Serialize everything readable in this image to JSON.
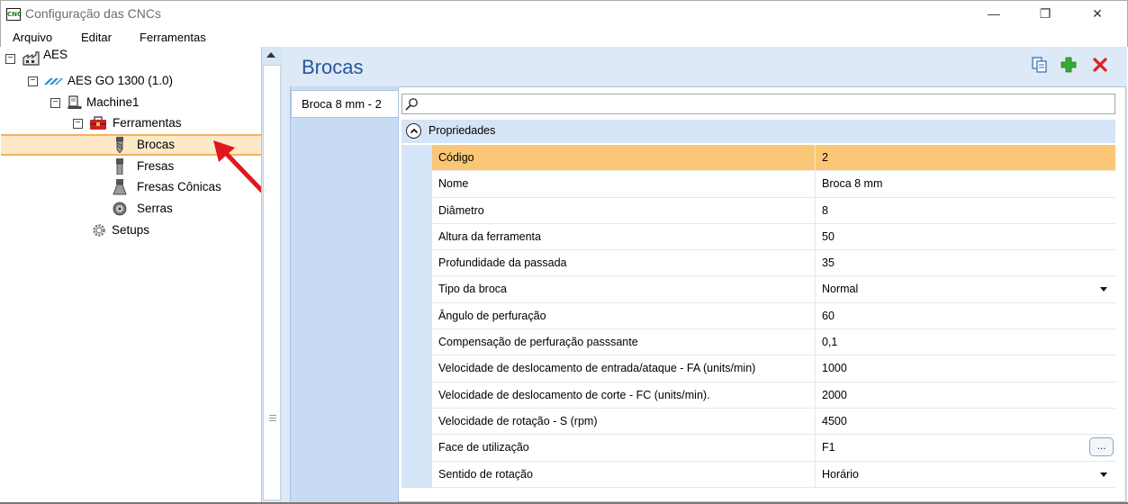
{
  "window": {
    "icon_text": "CNC",
    "title": "Configuração das CNCs",
    "minimize_glyph": "—",
    "maximize_glyph": "❐",
    "close_glyph": "✕"
  },
  "menu": [
    "Arquivo",
    "Editar",
    "Ferramentas"
  ],
  "tree": {
    "items": [
      {
        "label": "AES",
        "icon": "factory-icon",
        "expanded": true
      },
      {
        "label": "AES GO 1300 (1.0)",
        "icon": "machine-brand-icon",
        "expanded": true
      },
      {
        "label": "Machine1",
        "icon": "machine-icon",
        "expanded": true
      },
      {
        "label": "Ferramentas",
        "icon": "toolbox-icon",
        "expanded": true
      },
      {
        "label": "Brocas",
        "icon": "drill-bit-icon",
        "selected": true
      },
      {
        "label": "Fresas",
        "icon": "mill-icon"
      },
      {
        "label": "Fresas Cônicas",
        "icon": "conical-mill-icon"
      },
      {
        "label": "Serras",
        "icon": "saw-icon"
      },
      {
        "label": "Setups",
        "icon": "gear-icon"
      }
    ],
    "toggle_glyph": "−"
  },
  "panel": {
    "title": "Brocas",
    "actions": [
      {
        "name": "copy-icon"
      },
      {
        "name": "add-icon",
        "color": "#3aa838"
      },
      {
        "name": "delete-icon",
        "color": "#e02020"
      }
    ],
    "tabs": [
      {
        "label": "Broca 8 mm - 2"
      }
    ],
    "search": {
      "placeholder": ""
    },
    "category": "Propriedades",
    "properties": [
      {
        "name": "Código",
        "value": "2",
        "highlight": true
      },
      {
        "name": "Nome",
        "value": "Broca 8 mm"
      },
      {
        "name": "Diâmetro",
        "value": "8"
      },
      {
        "name": "Altura da ferramenta",
        "value": "50"
      },
      {
        "name": "Profundidade da passada",
        "value": "35"
      },
      {
        "name": "Tipo da broca",
        "value": "Normal",
        "editor": "dropdown"
      },
      {
        "name": "Ângulo de perfuração",
        "value": "60"
      },
      {
        "name": "Compensação de perfuração passsante",
        "value": "0,1"
      },
      {
        "name": "Velocidade de deslocamento de entrada/ataque - FA (units/min)",
        "value": "1000"
      },
      {
        "name": "Velocidade de deslocamento de corte - FC (units/min).",
        "value": "2000"
      },
      {
        "name": "Velocidade de rotação - S (rpm)",
        "value": "4500"
      },
      {
        "name": "Face de utilização",
        "value": "F1",
        "editor": "ellipsis",
        "button_label": "..."
      },
      {
        "name": "Sentido de rotação",
        "value": "Horário",
        "editor": "dropdown"
      }
    ]
  },
  "colors": {
    "accent_title": "#29569c",
    "selection_fill": "#fde9c8",
    "selection_border": "#f3b261",
    "highlight_row": "#f9c776",
    "panel_bg": "#dde9f6",
    "annotation_arrow": "#e0181b"
  }
}
